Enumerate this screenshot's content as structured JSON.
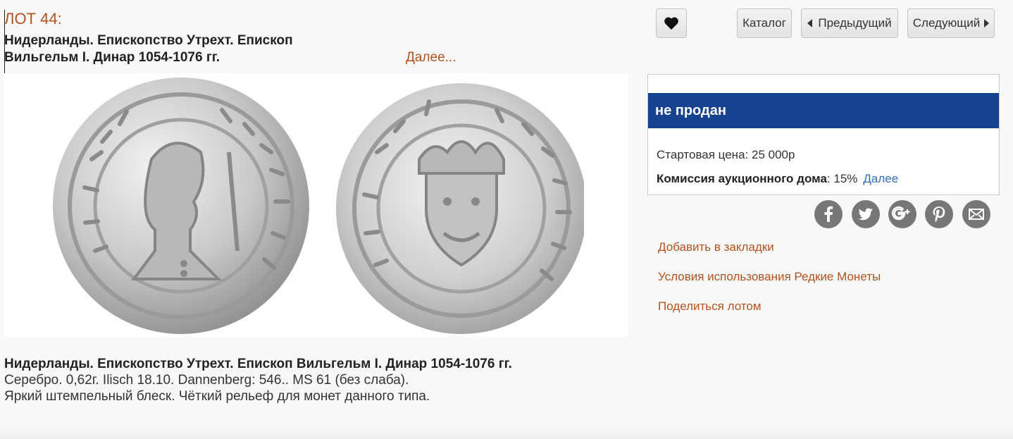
{
  "lot": {
    "number": "ЛОТ 44:",
    "title": "Нидерланды. Епископство Утрехт. Епископ Вильгельм I. Динар 1054-1076 гг.",
    "more_label": "Далее..."
  },
  "description": {
    "title": "Нидерланды. Епископство Утрехт. Епископ Вильгельм I. Динар 1054-1076 гг.",
    "line1": "Серебро. 0,62г. Ilisch 18.10. Dannenberg: 546.. MS 61 (без слаба).",
    "line2": "Яркий штемпельный блеск. Чёткий рельеф для монет данного типа."
  },
  "toolbar": {
    "favorite_icon": "heart-icon",
    "catalog_label": "Каталог",
    "prev_label": "Предыдущий",
    "next_label": "Следующий"
  },
  "status": {
    "banner": "не продан",
    "start_price_label": "Стартовая цена:",
    "start_price_value": "25 000р",
    "commission_label": "Комиссия аукционного дома",
    "commission_value": ": 15%",
    "commission_link": "Далее"
  },
  "share_icons": [
    "facebook-icon",
    "twitter-icon",
    "google-plus-icon",
    "pinterest-icon",
    "mail-icon"
  ],
  "side_links": {
    "bookmark": "Добавить в закладки",
    "terms": "Условия использования Редкие Монеты",
    "share": "Поделиться лотом"
  },
  "colors": {
    "accent": "#b4521f",
    "banner": "#17428f",
    "link_blue": "#2f6fbd",
    "social_gray": "#777777"
  }
}
